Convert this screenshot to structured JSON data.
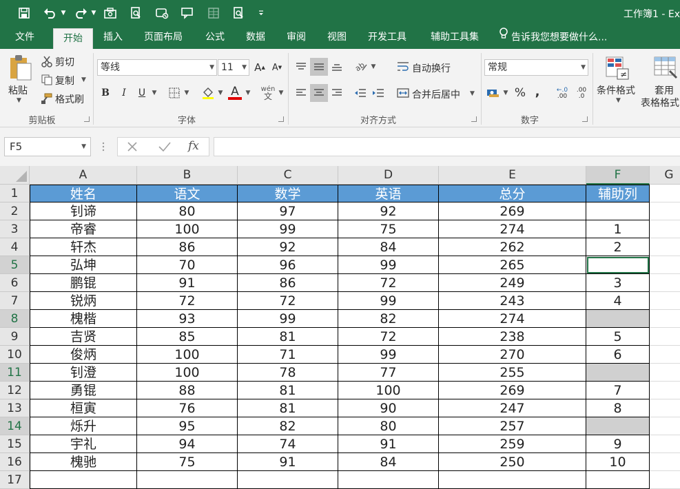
{
  "window": {
    "title": "工作簿1 - Ex"
  },
  "quick_access": {
    "icons": [
      "save-icon",
      "undo-icon",
      "redo-icon",
      "camera-icon",
      "print-preview-icon",
      "form-icon",
      "speech-icon",
      "table-icon",
      "zoom-doc-icon",
      "customize-icon"
    ]
  },
  "tabs": [
    "文件",
    "开始",
    "插入",
    "页面布局",
    "公式",
    "数据",
    "审阅",
    "视图",
    "开发工具",
    "辅助工具集"
  ],
  "tell_me": "告诉我您想要做什么...",
  "ribbon": {
    "clipboard": {
      "paste": "粘贴",
      "cut": "剪切",
      "copy": "复制",
      "format_painter": "格式刷",
      "group": "剪贴板"
    },
    "font": {
      "name": "等线",
      "size": "11",
      "group": "字体"
    },
    "alignment": {
      "wrap": "自动换行",
      "merge": "合并后居中",
      "group": "对齐方式"
    },
    "number": {
      "format": "常规",
      "percent": "%",
      "comma": ",",
      "inc_decimal": ".00",
      "dec_decimal": ".0",
      "group": "数字"
    },
    "styles": {
      "conditional": "条件格式",
      "table_line1": "套用",
      "table_line2": "表格格式"
    }
  },
  "formula_bar": {
    "name_box": "F5",
    "fx": "fx",
    "content": ""
  },
  "sheet": {
    "columns": [
      "A",
      "B",
      "C",
      "D",
      "E",
      "F",
      "G"
    ],
    "rows": [
      "1",
      "2",
      "3",
      "4",
      "5",
      "6",
      "7",
      "8",
      "9",
      "10",
      "11",
      "12",
      "13",
      "14",
      "15",
      "16",
      "17"
    ],
    "header": [
      "姓名",
      "语文",
      "数学",
      "英语",
      "总分",
      "辅助列"
    ],
    "data": [
      [
        "钊谛",
        "80",
        "97",
        "92",
        "269",
        ""
      ],
      [
        "帝睿",
        "100",
        "99",
        "75",
        "274",
        "1"
      ],
      [
        "轩杰",
        "86",
        "92",
        "84",
        "262",
        "2"
      ],
      [
        "弘坤",
        "70",
        "96",
        "99",
        "265",
        ""
      ],
      [
        "鹏锟",
        "91",
        "86",
        "72",
        "249",
        "3"
      ],
      [
        "锐炳",
        "72",
        "72",
        "99",
        "243",
        "4"
      ],
      [
        "槐楷",
        "93",
        "99",
        "82",
        "274",
        ""
      ],
      [
        "吉贤",
        "85",
        "81",
        "72",
        "238",
        "5"
      ],
      [
        "俊炳",
        "100",
        "71",
        "99",
        "270",
        "6"
      ],
      [
        "钊澄",
        "100",
        "78",
        "77",
        "255",
        ""
      ],
      [
        "勇锟",
        "88",
        "81",
        "100",
        "269",
        "7"
      ],
      [
        "桓寅",
        "76",
        "81",
        "90",
        "247",
        "8"
      ],
      [
        "烁升",
        "95",
        "82",
        "80",
        "257",
        ""
      ],
      [
        "宇礼",
        "94",
        "74",
        "91",
        "259",
        "9"
      ],
      [
        "槐驰",
        "75",
        "91",
        "84",
        "250",
        "10"
      ]
    ],
    "highlight_rows": [
      "5",
      "8",
      "11",
      "14"
    ],
    "selected_cell": "F5",
    "colors": {
      "header_fill": "#5b9bd5",
      "blank_fill": "#d0d0d0",
      "accent": "#217346"
    }
  }
}
